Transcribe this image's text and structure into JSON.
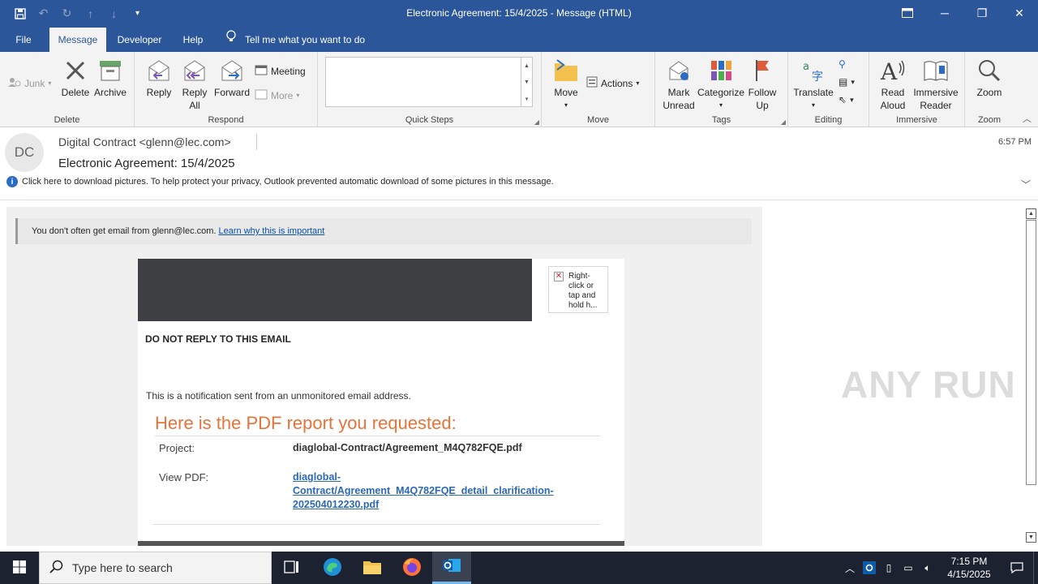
{
  "window": {
    "title": "Electronic Agreement: 15/4/2025  -  Message (HTML)"
  },
  "tabs": [
    {
      "label": "File"
    },
    {
      "label": "Message"
    },
    {
      "label": "Developer"
    },
    {
      "label": "Help"
    }
  ],
  "tell_me": "Tell me what you want to do",
  "ribbon": {
    "junk": "Junk",
    "delete": "Delete",
    "archive": "Archive",
    "reply": "Reply",
    "reply_all_1": "Reply",
    "reply_all_2": "All",
    "forward": "Forward",
    "meeting": "Meeting",
    "more": "More",
    "move": "Move",
    "actions": "Actions",
    "mark_unread_1": "Mark",
    "mark_unread_2": "Unread",
    "categorize": "Categorize",
    "follow_up_1": "Follow",
    "follow_up_2": "Up",
    "translate": "Translate",
    "read_aloud_1": "Read",
    "read_aloud_2": "Aloud",
    "immersive_reader_1": "Immersive",
    "immersive_reader_2": "Reader",
    "zoom": "Zoom",
    "groups": {
      "delete": "Delete",
      "respond": "Respond",
      "quick_steps": "Quick Steps",
      "move": "Move",
      "tags": "Tags",
      "editing": "Editing",
      "immersive": "Immersive",
      "zoom": "Zoom"
    }
  },
  "message": {
    "avatar_initials": "DC",
    "sender": "Digital Contract <glenn@lec.com>",
    "subject": "Electronic Agreement: 15/4/2025",
    "time": "6:57 PM",
    "info_bar": "Click here to download pictures. To help protect your privacy, Outlook prevented automatic download of some pictures in this message.",
    "warning_text": "You don't often get email from glenn@lec.com.",
    "warning_link": "Learn why this is important"
  },
  "email_body": {
    "broken_image_text": "Right-click or tap and hold h...",
    "do_not_reply": "DO NOT REPLY TO THIS EMAIL",
    "notification": "This is a notification sent from an unmonitored email address.",
    "heading": "Here is the PDF report you requested:",
    "project_label": "Project:",
    "project_value": "diaglobal-Contract/Agreement_M4Q782FQE.pdf",
    "view_label": "View PDF:",
    "view_link": "diaglobal-Contract/Agreement_M4Q782FQE_detail_clarification-202504012230.pdf"
  },
  "watermark": "ANY RUN",
  "taskbar": {
    "search_placeholder": "Type here to search",
    "time": "7:15 PM",
    "date": "4/15/2025"
  },
  "colors": {
    "title_bar": "#2b579a",
    "heading_orange": "#e8733a",
    "link_blue": "#2b68b6",
    "taskbar": "#1c2230"
  }
}
